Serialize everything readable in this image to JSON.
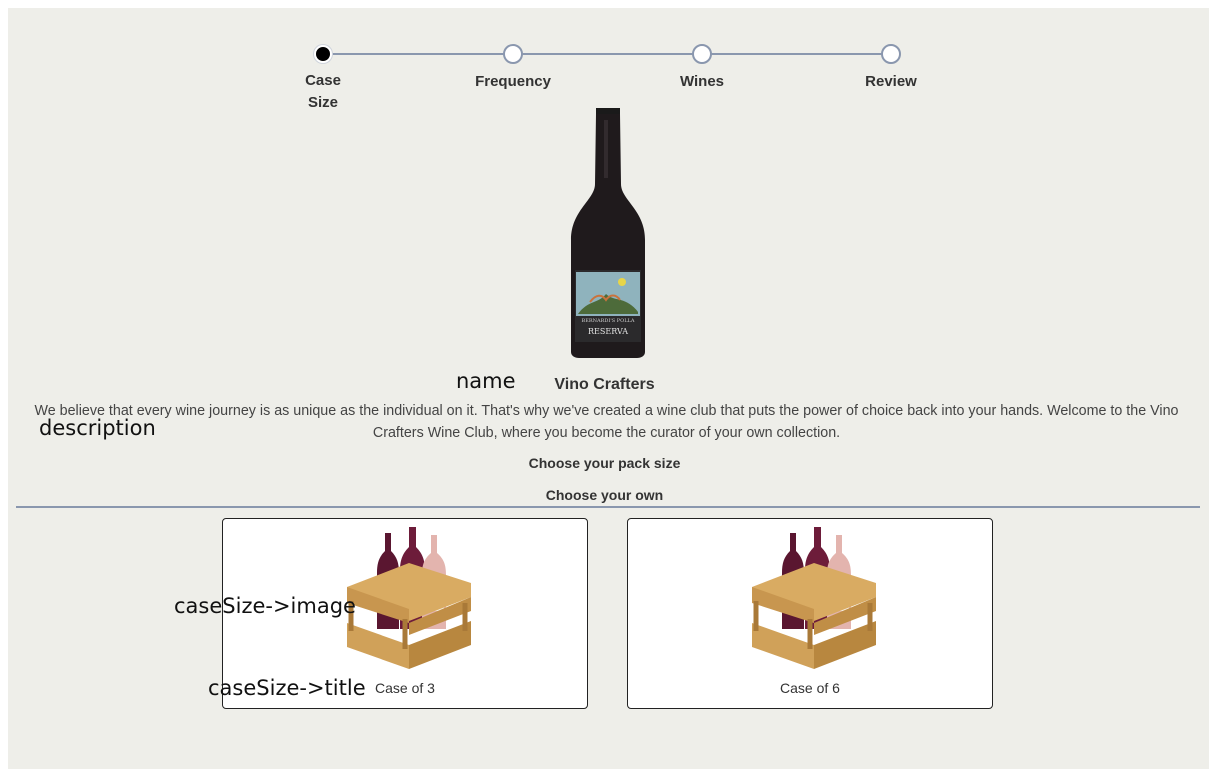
{
  "stepper": {
    "steps": [
      {
        "label": "Case Size",
        "active": true
      },
      {
        "label": "Frequency",
        "active": false
      },
      {
        "label": "Wines",
        "active": false
      },
      {
        "label": "Review",
        "active": false
      }
    ]
  },
  "annotations": {
    "name": "name",
    "description": "description",
    "case_image": "caseSize->image",
    "case_title": "caseSize->title"
  },
  "club": {
    "name": "Vino Crafters",
    "description": "We believe that every wine journey is as unique as the individual on it. That's why we've created a wine club that puts the power of choice back into your hands. Welcome to the Vino Crafters Wine Club, where you become the curator of your own collection."
  },
  "pack": {
    "heading": "Choose your pack size",
    "subheading": "Choose your own",
    "cases": [
      {
        "title": "Case of 3",
        "icon": "wine-crate-icon"
      },
      {
        "title": "Case of 6",
        "icon": "wine-crate-icon"
      }
    ]
  },
  "bottle_label": {
    "line1": "BERNARDI'S POLLA",
    "line2": "RESERVA"
  },
  "colors": {
    "background": "#eeeee9",
    "accent": "#8a97ae",
    "active_step": "#000000"
  }
}
